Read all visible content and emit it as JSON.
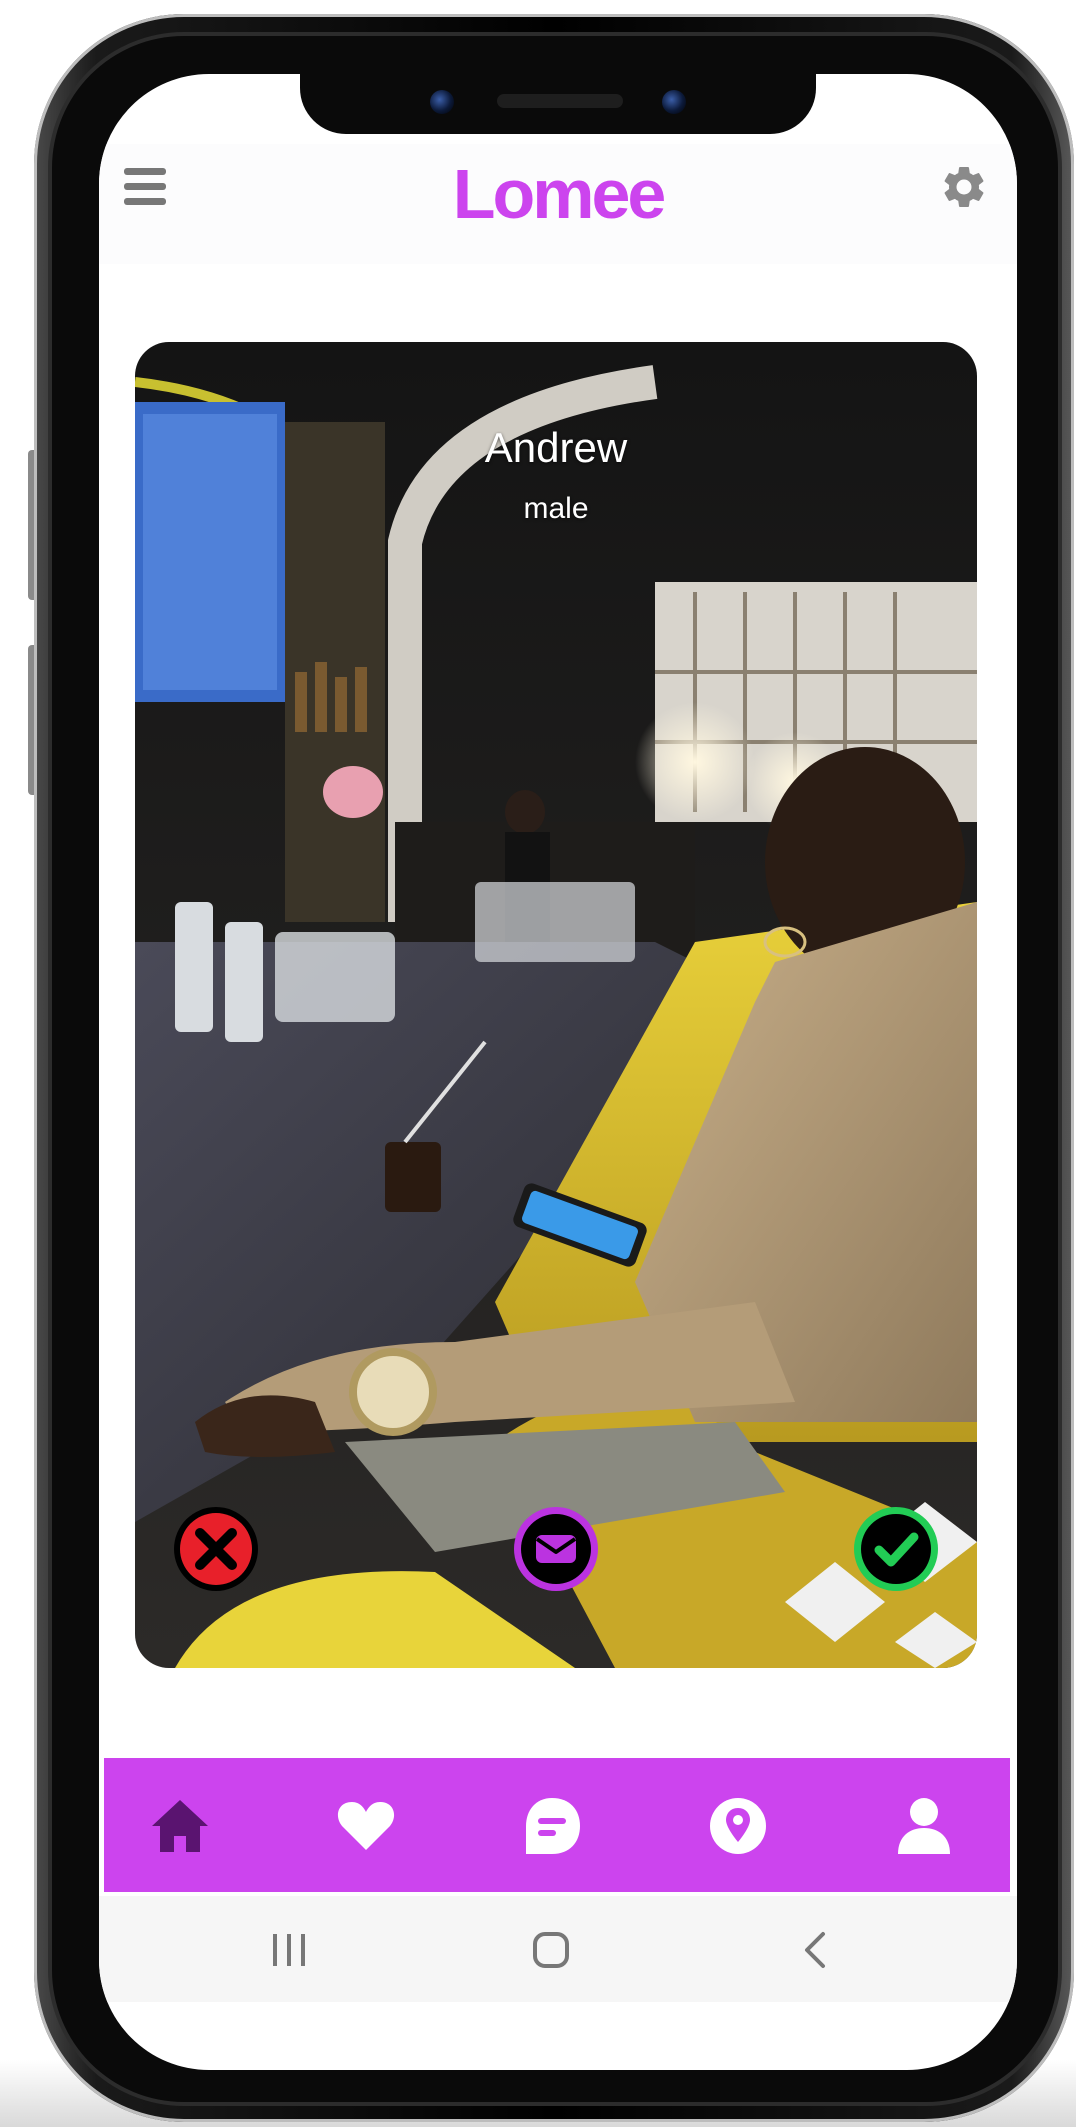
{
  "app": {
    "title": "Lomee"
  },
  "profile": {
    "name": "Andrew",
    "gender": "male"
  },
  "actions": {
    "reject": "close-icon",
    "message": "envelope-icon",
    "accept": "check-icon"
  },
  "bottom_nav": {
    "items": [
      {
        "icon": "home-icon",
        "active": true
      },
      {
        "icon": "heart-icon",
        "active": false
      },
      {
        "icon": "chat-icon",
        "active": false
      },
      {
        "icon": "location-pin-icon",
        "active": false
      },
      {
        "icon": "user-icon",
        "active": false
      }
    ]
  },
  "colors": {
    "brand": "#cc44ee",
    "nav_active": "#5a1470",
    "reject": "#e8202a",
    "message": "#bb33e0",
    "accept": "#22cc55"
  }
}
